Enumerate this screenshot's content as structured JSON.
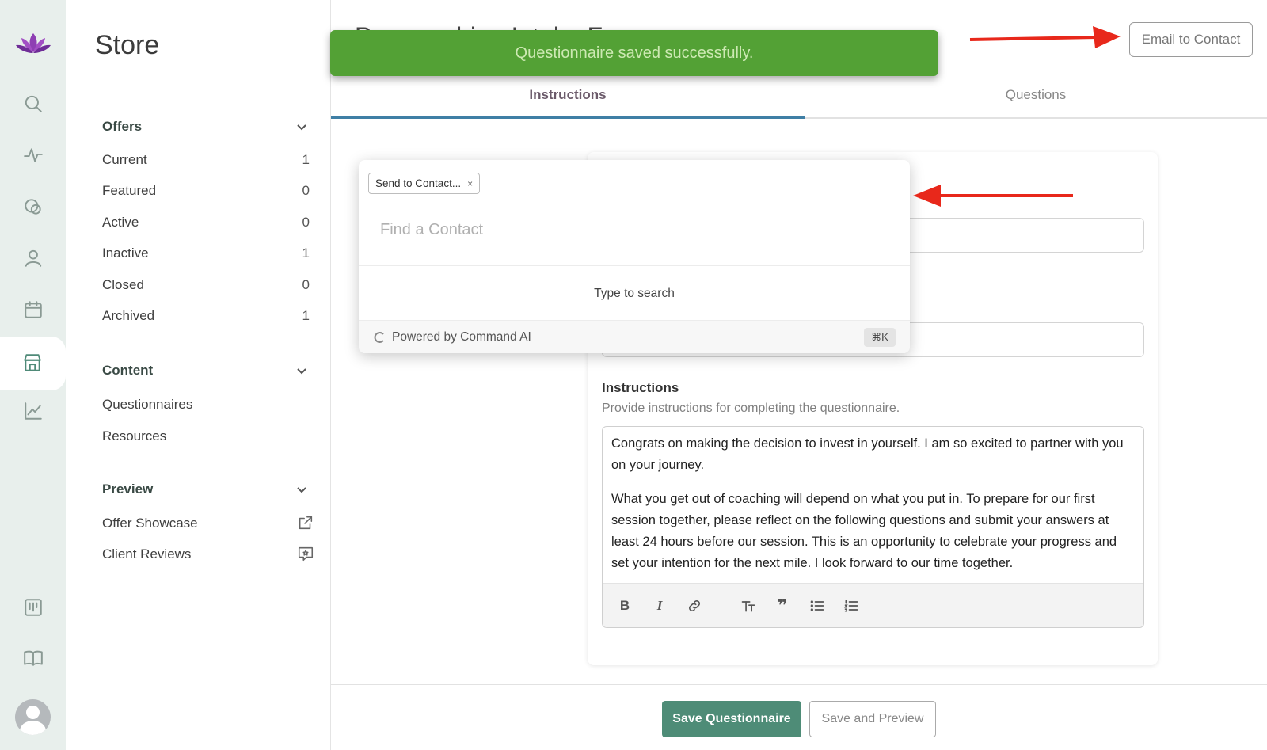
{
  "rail": {
    "icons": [
      "logo-lotus-icon",
      "search-icon",
      "activity-icon",
      "chat-icon",
      "user-icon",
      "calendar-icon",
      "store-icon",
      "chart-icon",
      "board-icon",
      "book-icon",
      "avatar"
    ],
    "accent": "#7b3fa8"
  },
  "sidebar": {
    "title": "Store",
    "offers": {
      "label": "Offers",
      "items": [
        {
          "label": "Current",
          "count": "1"
        },
        {
          "label": "Featured",
          "count": "0"
        },
        {
          "label": "Active",
          "count": "0"
        },
        {
          "label": "Inactive",
          "count": "1"
        },
        {
          "label": "Closed",
          "count": "0"
        },
        {
          "label": "Archived",
          "count": "1"
        }
      ]
    },
    "content": {
      "label": "Content",
      "items": [
        {
          "label": "Questionnaires"
        },
        {
          "label": "Resources"
        }
      ]
    },
    "preview": {
      "label": "Preview",
      "items": [
        {
          "label": "Offer Showcase",
          "icon": "external-link-icon"
        },
        {
          "label": "Client Reviews",
          "icon": "review-icon"
        }
      ]
    }
  },
  "main": {
    "page_title": "Pre-coaching Intake Form",
    "email_button": "Email to Contact",
    "tabs": [
      {
        "label": "Instructions",
        "active": true
      },
      {
        "label": "Questions",
        "active": false
      }
    ],
    "instructions": {
      "label": "Instructions",
      "hint": "Provide instructions for completing the questionnaire.",
      "paragraphs": [
        "Congrats on making the decision to invest in yourself. I am so excited to partner with you on your journey.",
        "What you get out of coaching will depend on what you put in. To prepare for our first session together, please reflect on the following questions and submit your answers at least 24 hours before our session. This is an opportunity to celebrate your progress and set your intention for the next mile. I look forward to our time together."
      ]
    },
    "toolbar": [
      "bold-icon",
      "italic-icon",
      "link-icon",
      "heading-icon",
      "quote-icon",
      "bullet-list-icon",
      "numbered-list-icon"
    ],
    "save_button": "Save Questionnaire",
    "preview_button": "Save and Preview"
  },
  "toast": {
    "message": "Questionnaire saved successfully.",
    "color": "#53a135"
  },
  "command": {
    "chip": "Send to Contact...",
    "chip_close": "×",
    "placeholder": "Find a Contact",
    "empty": "Type to search",
    "powered": "Powered by Command AI",
    "shortcut": "⌘K"
  },
  "annotation_color": "#e8281b"
}
